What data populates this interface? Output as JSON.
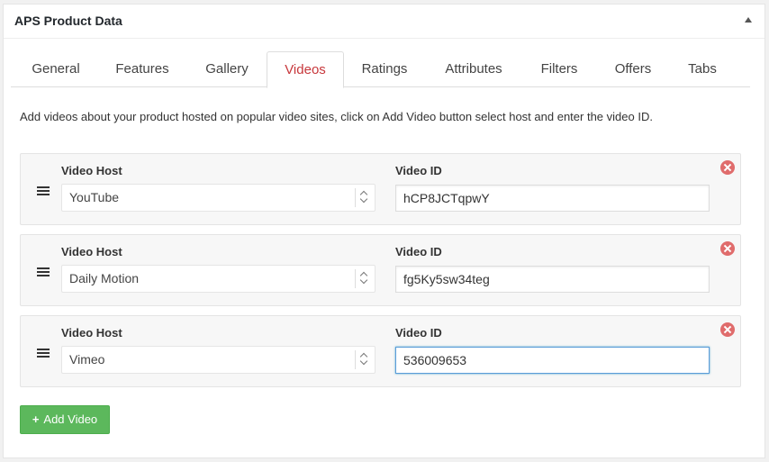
{
  "header": {
    "title": "APS Product Data",
    "collapse_icon": "triangle-up-icon"
  },
  "tabs": [
    {
      "label": "General"
    },
    {
      "label": "Features"
    },
    {
      "label": "Gallery"
    },
    {
      "label": "Videos",
      "active": true
    },
    {
      "label": "Ratings"
    },
    {
      "label": "Attributes"
    },
    {
      "label": "Filters"
    },
    {
      "label": "Offers"
    },
    {
      "label": "Tabs"
    }
  ],
  "description": "Add videos about your product hosted on popular video sites, click on Add Video button select host and enter the video ID.",
  "videos": [
    {
      "host_label": "Video Host",
      "host_value": "YouTube",
      "id_label": "Video ID",
      "id_value": "hCP8JCTqpwY"
    },
    {
      "host_label": "Video Host",
      "host_value": "Daily Motion",
      "id_label": "Video ID",
      "id_value": "fg5Ky5sw34teg"
    },
    {
      "host_label": "Video Host",
      "host_value": "Vimeo",
      "id_label": "Video ID",
      "id_value": "536009653"
    }
  ],
  "add_button": {
    "icon": "+",
    "label": "Add Video"
  },
  "colors": {
    "active_tab": "#c7373b",
    "add_button": "#5cb85c",
    "remove_icon": "#e06c6c"
  }
}
